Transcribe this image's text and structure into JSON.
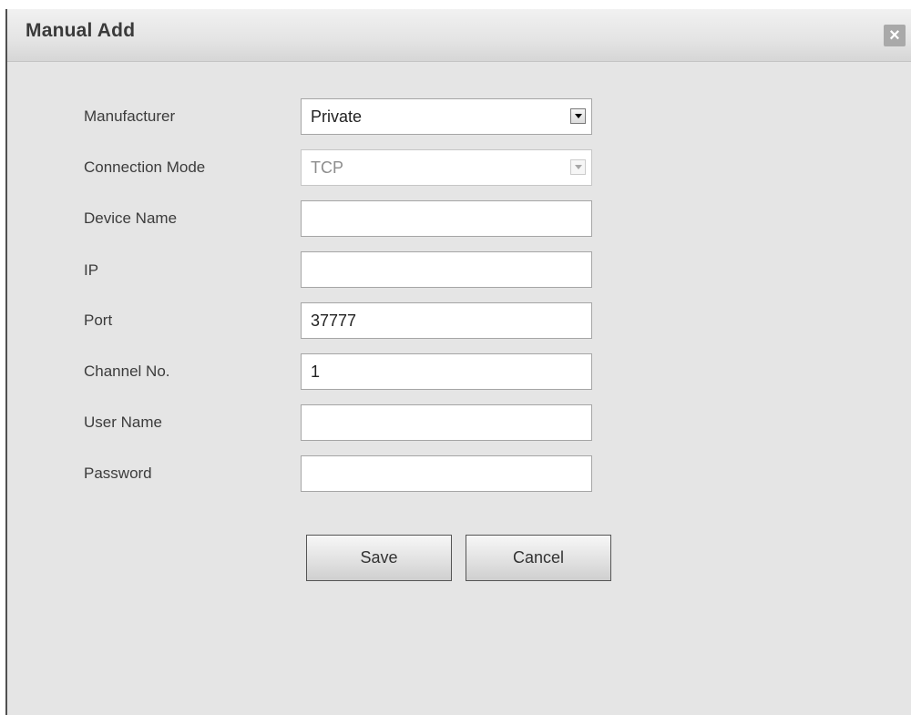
{
  "dialog": {
    "title": "Manual Add",
    "close_glyph": "×"
  },
  "form": {
    "manufacturer": {
      "label": "Manufacturer",
      "value": "Private"
    },
    "connection_mode": {
      "label": "Connection Mode",
      "value": "TCP",
      "disabled": true
    },
    "device_name": {
      "label": "Device Name",
      "value": ""
    },
    "ip": {
      "label": "IP",
      "value": ""
    },
    "port": {
      "label": "Port",
      "value": "37777"
    },
    "channel_no": {
      "label": "Channel No.",
      "value": "1"
    },
    "user_name": {
      "label": "User Name",
      "value": ""
    },
    "password": {
      "label": "Password",
      "value": ""
    }
  },
  "buttons": {
    "save": "Save",
    "cancel": "Cancel"
  }
}
